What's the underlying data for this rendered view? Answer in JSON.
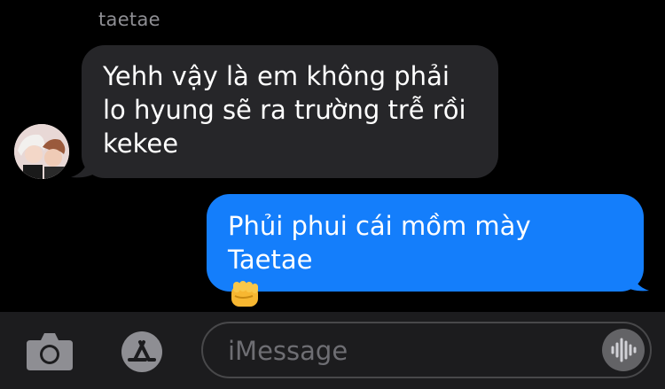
{
  "conversation": {
    "sender_name": "taetae",
    "messages": [
      {
        "direction": "incoming",
        "text": "Yehh vậy là em không phải lo hyung sẽ ra trường trễ rồi kekee"
      },
      {
        "direction": "outgoing",
        "text": "Phủi phui cái mồm mày Taetae",
        "emoji": "fist-icon"
      }
    ]
  },
  "compose": {
    "placeholder": "iMessage"
  },
  "colors": {
    "incoming_bubble": "#262629",
    "outgoing_bubble": "#147efb",
    "background": "#000000",
    "input_bar": "#1c1c1e"
  }
}
